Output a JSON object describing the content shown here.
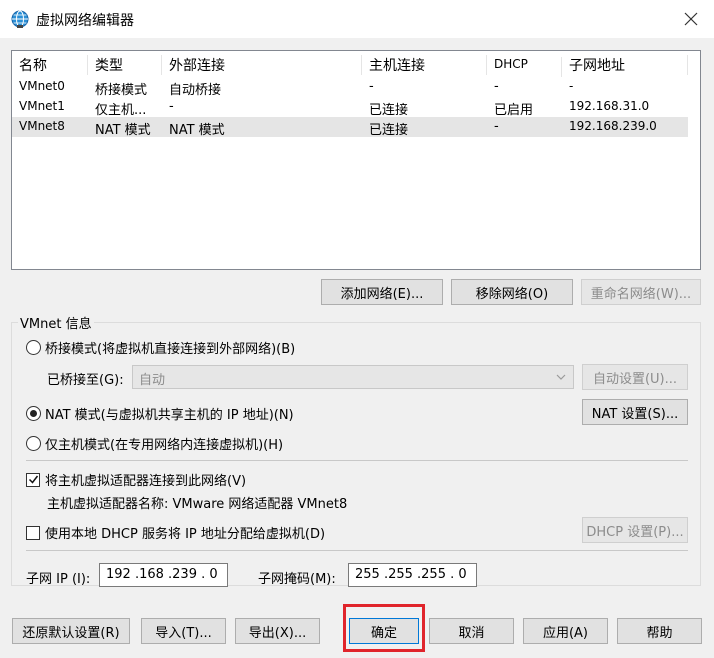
{
  "window": {
    "title": "虚拟网络编辑器"
  },
  "list": {
    "columns": [
      "名称",
      "类型",
      "外部连接",
      "主机连接",
      "DHCP",
      "子网地址"
    ],
    "rows": [
      {
        "name": "VMnet0",
        "type": "桥接模式",
        "external": "自动桥接",
        "host": "-",
        "dhcp": "-",
        "subnet": "-"
      },
      {
        "name": "VMnet1",
        "type": "仅主机...",
        "external": "-",
        "host": "已连接",
        "dhcp": "已启用",
        "subnet": "192.168.31.0"
      },
      {
        "name": "VMnet8",
        "type": "NAT 模式",
        "external": "NAT 模式",
        "host": "已连接",
        "dhcp": "-",
        "subnet": "192.168.239.0"
      }
    ],
    "selected_index": 2
  },
  "list_buttons": {
    "add": "添加网络(E)...",
    "remove": "移除网络(O)",
    "rename": "重命名网络(W)..."
  },
  "info": {
    "group_label": "VMnet 信息",
    "bridged_label": "桥接模式(将虚拟机直接连接到外部网络)(B)",
    "bridged_to_label": "已桥接至(G):",
    "bridged_to_value": "自动",
    "auto_settings": "自动设置(U)...",
    "nat_label": "NAT 模式(与虚拟机共享主机的 IP 地址)(N)",
    "nat_settings": "NAT 设置(S)...",
    "hostonly_label": "仅主机模式(在专用网络内连接虚拟机)(H)",
    "connect_adapter_label": "将主机虚拟适配器连接到此网络(V)",
    "adapter_name_label": "主机虚拟适配器名称: VMware 网络适配器 VMnet8",
    "dhcp_label": "使用本地 DHCP 服务将 IP 地址分配给虚拟机(D)",
    "dhcp_settings": "DHCP 设置(P)...",
    "subnet_ip_label": "子网 IP (I):",
    "subnet_ip_value": "192 .168 .239 .  0",
    "subnet_mask_label": "子网掩码(M):",
    "subnet_mask_value": "255 .255 .255 .  0",
    "selected_mode": "nat",
    "connect_adapter_checked": true,
    "dhcp_checked": false
  },
  "footer": {
    "restore": "还原默认设置(R)",
    "import": "导入(T)...",
    "export": "导出(X)...",
    "ok": "确定",
    "cancel": "取消",
    "apply": "应用(A)",
    "help": "帮助"
  },
  "colors": {
    "highlight": "#e0242b",
    "selection": "#e5e5e5"
  }
}
